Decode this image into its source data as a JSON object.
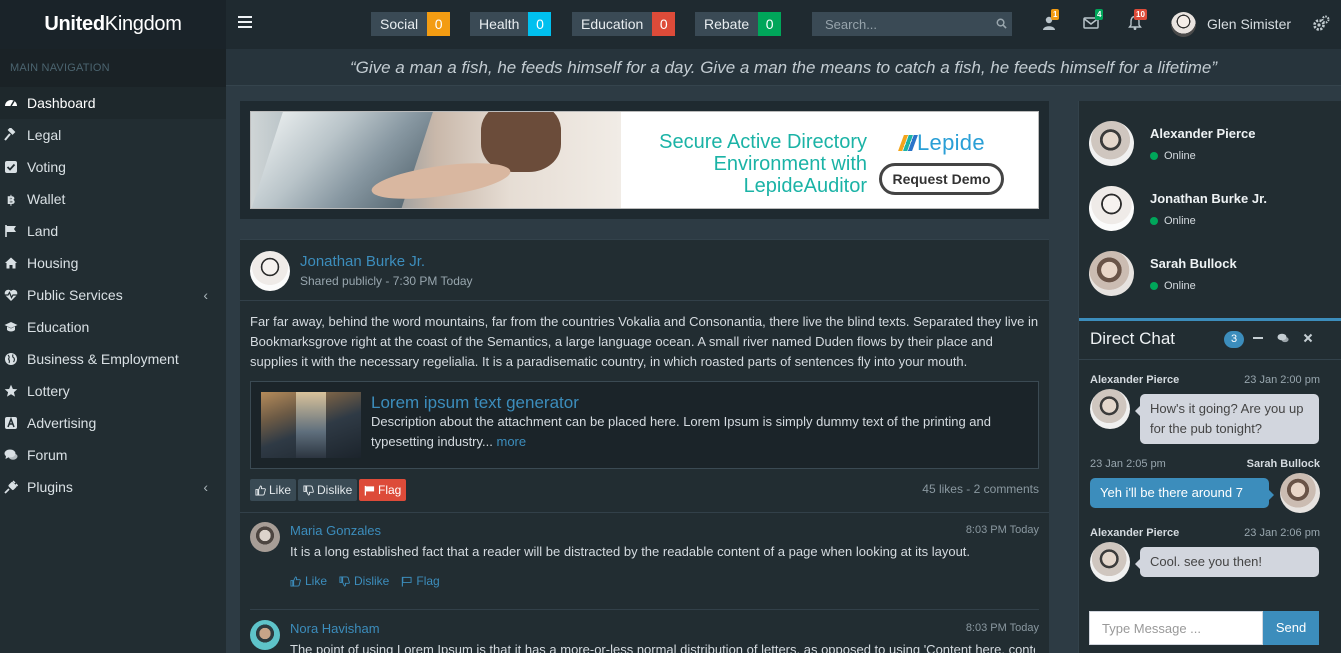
{
  "brand": {
    "bold": "United",
    "rest": "Kingdom"
  },
  "top_pills": [
    {
      "label": "Social",
      "count": "0",
      "color": "#f39c12"
    },
    {
      "label": "Health",
      "count": "0",
      "color": "#00c0ef"
    },
    {
      "label": "Education",
      "count": "0",
      "color": "#dd4b39"
    },
    {
      "label": "Rebate",
      "count": "0",
      "color": "#00a65a"
    }
  ],
  "search": {
    "placeholder": "Search..."
  },
  "notifications": {
    "users": "1",
    "messages": "4",
    "alerts": "10"
  },
  "user": {
    "name": "Glen Simister"
  },
  "sidebar": {
    "header": "MAIN NAVIGATION",
    "items": [
      {
        "label": "Dashboard",
        "icon": "dashboard-icon"
      },
      {
        "label": "Legal",
        "icon": "gavel-icon"
      },
      {
        "label": "Voting",
        "icon": "checkbox-icon"
      },
      {
        "label": "Wallet",
        "icon": "bitcoin-icon"
      },
      {
        "label": "Land",
        "icon": "flag-icon"
      },
      {
        "label": "Housing",
        "icon": "home-icon"
      },
      {
        "label": "Public Services",
        "icon": "heartbeat-icon",
        "expand": "‹"
      },
      {
        "label": "Education",
        "icon": "graduation-cap-icon"
      },
      {
        "label": "Business & Employment",
        "icon": "globe-icon"
      },
      {
        "label": "Lottery",
        "icon": "star-icon"
      },
      {
        "label": "Advertising",
        "icon": "ad-icon"
      },
      {
        "label": "Forum",
        "icon": "comments-icon"
      },
      {
        "label": "Plugins",
        "icon": "plug-icon",
        "expand": "‹"
      }
    ]
  },
  "quote": "“Give a man a fish, he feeds himself for a day. Give a man the means to catch a fish, he feeds himself for a lifetime”",
  "ad": {
    "line1": "Secure Active Directory",
    "line2": "Environment with",
    "line3": "LepideAuditor",
    "logo": "Lepide",
    "button": "Request Demo"
  },
  "post": {
    "author": "Jonathan Burke Jr.",
    "meta": "Shared publicly - 7:30 PM Today",
    "body": "Far far away, behind the word mountains, far from the countries Vokalia and Consonantia, there live the blind texts. Separated they live in Bookmarksgrove right at the coast of the Semantics, a large language ocean. A small river named Duden flows by their place and supplies it with the necessary regelialia. It is a paradisematic country, in which roasted parts of sentences fly into your mouth.",
    "attachment": {
      "title": "Lorem ipsum text generator",
      "desc": "Description about the attachment can be placed here. Lorem Ipsum is simply dummy text of the printing and typesetting industry...",
      "more": "more"
    },
    "like": "Like",
    "dislike": "Dislike",
    "flag": "Flag",
    "stats": "45 likes - 2 comments"
  },
  "comments": [
    {
      "name": "Maria Gonzales",
      "time": "8:03 PM Today",
      "text": "It is a long established fact that a reader will be distracted by the readable content of a page when looking at its layout.",
      "like": "Like",
      "dislike": "Dislike",
      "flag": "Flag"
    },
    {
      "name": "Nora Havisham",
      "time": "8:03 PM Today",
      "text": "The point of using Lorem Ipsum is that it has a more-or-less normal distribution of letters, as opposed to using 'Content here, content here'"
    }
  ],
  "contacts": [
    {
      "name": "Alexander Pierce",
      "status": "Online"
    },
    {
      "name": "Jonathan Burke Jr.",
      "status": "Online"
    },
    {
      "name": "Sarah Bullock",
      "status": "Online"
    }
  ],
  "chat": {
    "title": "Direct Chat",
    "count": "3",
    "messages": [
      {
        "name": "Alexander Pierce",
        "time": "23 Jan 2:00 pm",
        "text": "How's it going? Are you up for the pub tonight?"
      },
      {
        "name": "Sarah Bullock",
        "time": "23 Jan 2:05 pm",
        "text": "Yeh i'll be there around 7"
      },
      {
        "name": "Alexander Pierce",
        "time": "23 Jan 2:06 pm",
        "text": "Cool. see you then!"
      }
    ],
    "input_placeholder": "Type Message ...",
    "send": "Send"
  }
}
